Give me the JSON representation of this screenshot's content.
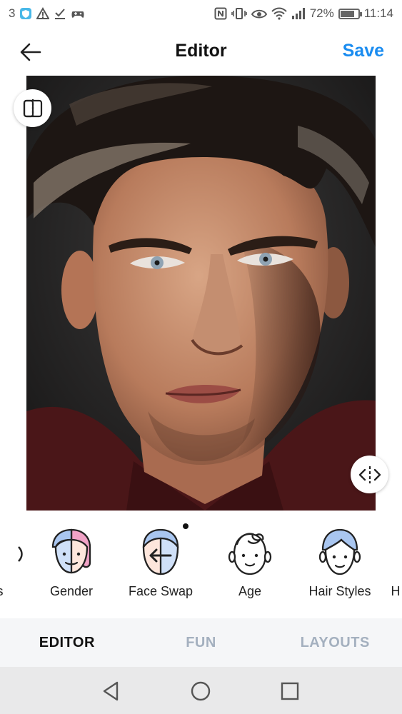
{
  "status_bar": {
    "notification_count": "3",
    "battery_percent": "72%",
    "battery_level": 0.72,
    "time": "11:14",
    "icons_left": [
      "shield-badge-icon",
      "warning-icon",
      "download-done-icon",
      "game-controller-icon"
    ],
    "icons_right": [
      "nfc-icon",
      "vibrate-icon",
      "eye-icon",
      "wifi-icon",
      "signal-icon",
      "battery-icon"
    ]
  },
  "header": {
    "title": "Editor",
    "save_label": "Save",
    "accent_color": "#1a8cf0"
  },
  "features": [
    {
      "label": "s",
      "icon": "partial-feature-icon"
    },
    {
      "label": "Gender",
      "icon": "gender-face-icon"
    },
    {
      "label": "Face Swap",
      "icon": "face-swap-icon"
    },
    {
      "label": "Age",
      "icon": "age-face-icon"
    },
    {
      "label": "Hair Styles",
      "icon": "hair-styles-icon"
    },
    {
      "label": "H",
      "icon": "partial-feature-icon"
    }
  ],
  "tabs": [
    {
      "label": "EDITOR",
      "active": true
    },
    {
      "label": "FUN",
      "active": false
    },
    {
      "label": "LAYOUTS",
      "active": false
    }
  ],
  "system_nav": [
    "back-triangle-icon",
    "home-circle-icon",
    "recents-square-icon"
  ]
}
